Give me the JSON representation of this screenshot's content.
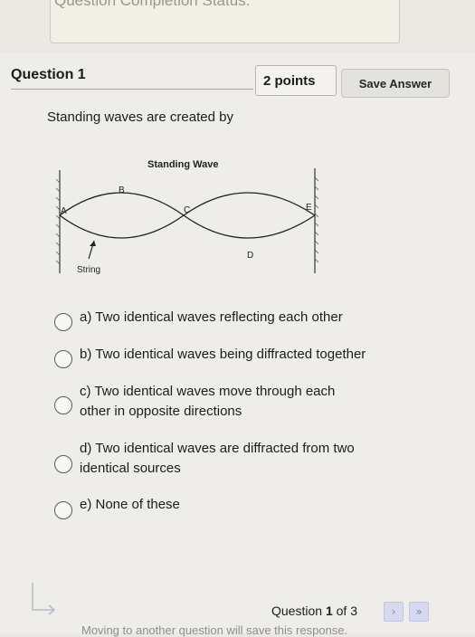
{
  "top": {
    "status_text": "Question Completion Status:"
  },
  "question": {
    "title": "Question 1",
    "points": "2 points",
    "save_label": "Save Answer",
    "text": "Standing waves are created by"
  },
  "figure": {
    "title": "Standing Wave",
    "labels": {
      "a": "A",
      "b": "B",
      "c": "C",
      "d": "D",
      "e": "E"
    },
    "string_label": "String"
  },
  "options": [
    {
      "lines": [
        "a) Two identical waves reflecting each other"
      ]
    },
    {
      "lines": [
        "b) Two identical waves being diffracted together"
      ]
    },
    {
      "lines": [
        "c) Two identical waves move through each",
        "other in opposite directions"
      ]
    },
    {
      "lines": [
        "d) Two identical waves are diffracted from two",
        "identical sources"
      ]
    },
    {
      "lines": [
        "e) None of these"
      ]
    }
  ],
  "footer": {
    "prefix": "Question",
    "current": "1",
    "of_text": "of 3",
    "next_label": "›",
    "last_label": "»",
    "bottom_text": "Moving to another question will save this response."
  }
}
